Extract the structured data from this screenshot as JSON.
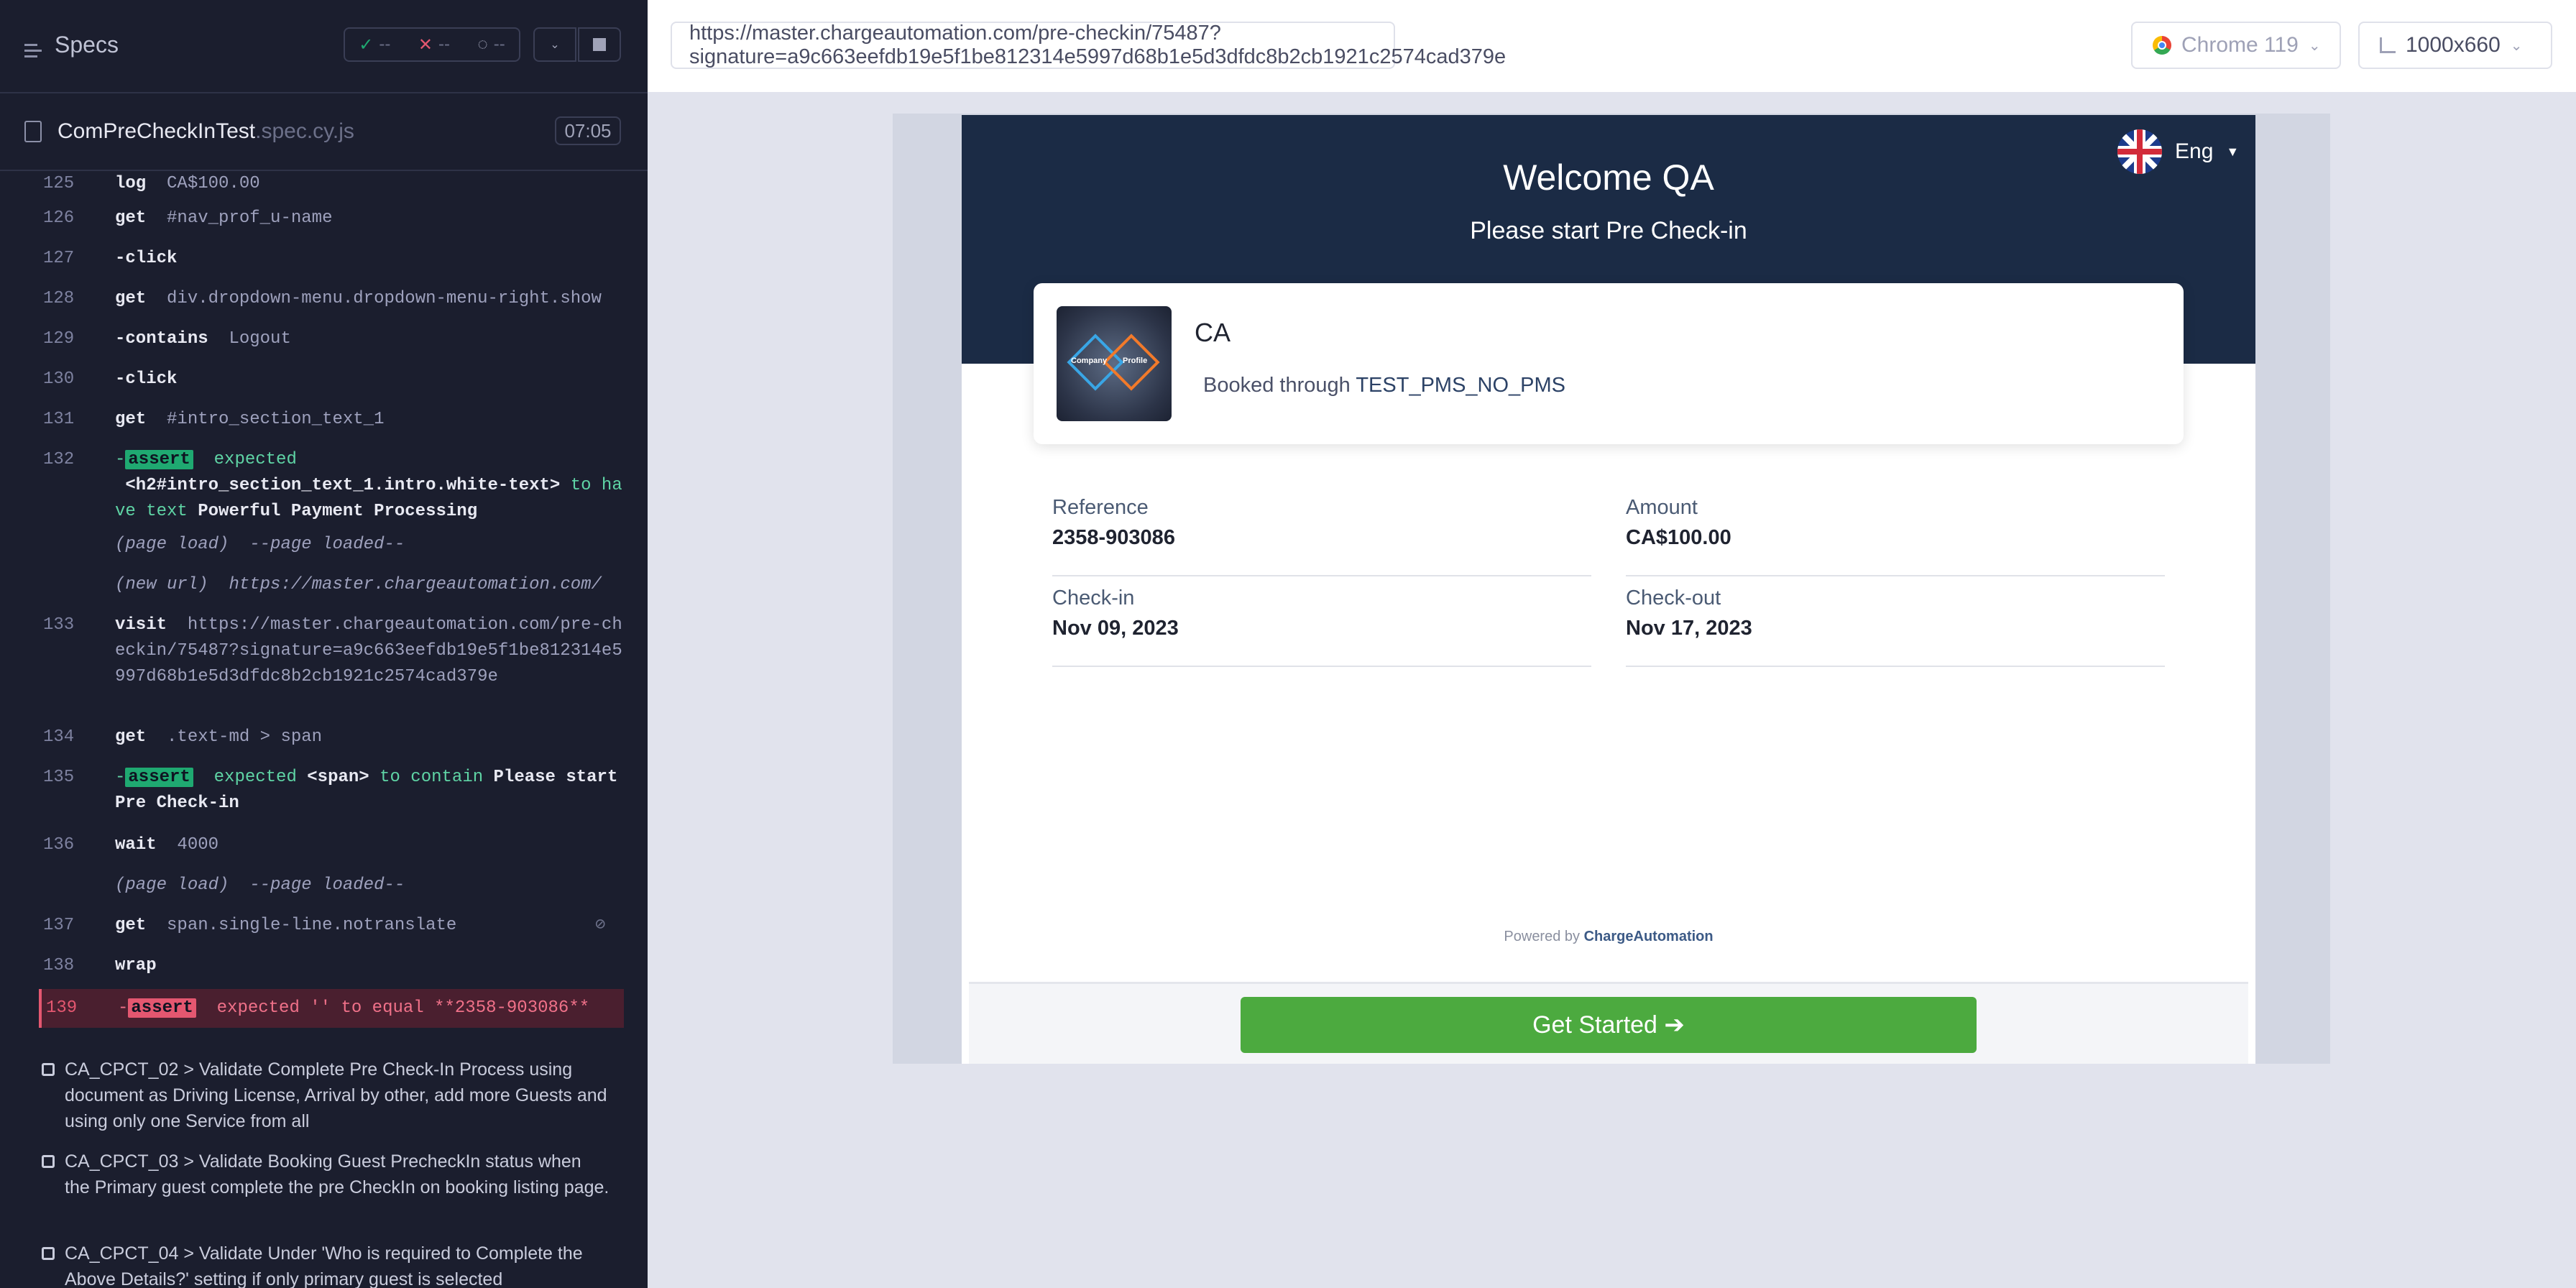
{
  "reporter": {
    "title": "Specs",
    "stats": {
      "passed": "--",
      "failed": "--",
      "pending": "--"
    },
    "spec": {
      "name": "ComPreCheckInTest",
      "ext": ".spec.cy.js",
      "time": "07:05"
    },
    "commands": [
      {
        "num": "125",
        "name": "log",
        "arg": "CA$100.00"
      },
      {
        "num": "126",
        "name": "get",
        "arg": "#nav_prof_u-name"
      },
      {
        "num": "127",
        "name": "-click",
        "arg": ""
      },
      {
        "num": "128",
        "name": "get",
        "arg": "div.dropdown-menu.dropdown-menu-right.show"
      },
      {
        "num": "129",
        "name": "-contains",
        "arg": "Logout"
      },
      {
        "num": "130",
        "name": "-click",
        "arg": ""
      },
      {
        "num": "131",
        "name": "get",
        "arg": "#intro_section_text_1"
      },
      {
        "num": "132",
        "name": "assert",
        "pre": "expected",
        "subj": "<h2#intro_section_text_1.intro.white-text>",
        "mid": "to have text",
        "val": "Powerful Payment Processing"
      },
      {
        "num": "",
        "name": "(page load)",
        "arg": "--page loaded--"
      },
      {
        "num": "",
        "name": "(new url)",
        "arg": "https://master.chargeautomation.com/"
      },
      {
        "num": "133",
        "name": "visit",
        "arg": "https://master.chargeautomation.com/pre-checkin/75487?signature=a9c663eefdb19e5f1be812314e5997d68b1e5d3dfdc8b2cb1921c2574cad379e"
      },
      {
        "num": "134",
        "name": "get",
        "arg": ".text-md > span"
      },
      {
        "num": "135",
        "name": "assert",
        "pre": "expected",
        "subj": "<span>",
        "mid": "to contain",
        "val": "Please start Pre Check-in"
      },
      {
        "num": "136",
        "name": "wait",
        "arg": "4000"
      },
      {
        "num": "",
        "name": "(page load)",
        "arg": "--page loaded--"
      },
      {
        "num": "137",
        "name": "get",
        "arg": "span.single-line.notranslate"
      },
      {
        "num": "138",
        "name": "wrap",
        "arg": ""
      },
      {
        "num": "139",
        "name": "assert",
        "text": "expected '' to equal **2358-903086**"
      }
    ],
    "tests": [
      "CA_CPCT_02 > Validate Complete Pre Check-In Process using document as Driving License, Arrival by other, add more Guests and using only one Service from all",
      "CA_CPCT_03 > Validate Booking Guest PrecheckIn status when the Primary guest complete the pre CheckIn on booking listing page.",
      "CA_CPCT_04 > Validate Under 'Who is required to Complete the Above Details?' setting if only primary guest is selected"
    ]
  },
  "browser": {
    "url": "https://master.chargeautomation.com/pre-checkin/75487?signature=a9c663eefdb19e5f1be812314e5997d68b1e5d3dfdc8b2cb1921c2574cad379e",
    "name": "Chrome 119",
    "viewport": "1000x660"
  },
  "app": {
    "welcome": "Welcome QA",
    "subtitle": "Please start Pre Check-in",
    "language": "Eng",
    "logo_text_left": "Company",
    "logo_text_right": "Profile",
    "property_name": "CA",
    "booked_prefix": "Booked through",
    "booked_source": "TEST_PMS_NO_PMS",
    "fields": {
      "reference_label": "Reference",
      "reference_value": "2358-903086",
      "amount_label": "Amount",
      "amount_value": "CA$100.00",
      "checkin_label": "Check-in",
      "checkin_value": "Nov 09, 2023",
      "checkout_label": "Check-out",
      "checkout_value": "Nov 17, 2023"
    },
    "powered_prefix": "Powered by",
    "powered_brand": "ChargeAutomation",
    "cta": "Get Started ➔"
  },
  "colors": {
    "hero": "#1b2b45",
    "cta": "#4caa3f",
    "reporter_bg": "#1b1e2e",
    "assert_pass": "#1fa971",
    "assert_fail": "#e45770"
  }
}
